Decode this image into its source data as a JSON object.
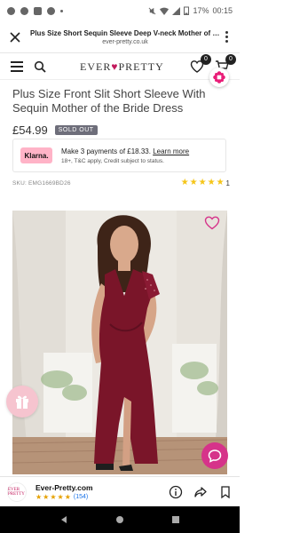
{
  "status_bar": {
    "battery": "17%",
    "time": "00:15"
  },
  "tab_header": {
    "title": "Plus Size Short Sequin Sleeve Deep V-neck Mother of the...",
    "url": "ever-pretty.co.uk"
  },
  "nav": {
    "logo_left": "EVER",
    "logo_right": "PRETTY",
    "wishlist_count": "0",
    "cart_count": "0"
  },
  "product": {
    "title": "Plus Size Front Slit Short Sleeve With Sequin Mother of the Bride Dress",
    "price": "£54.99",
    "stock_badge": "SOLD OUT",
    "sku": "SKU: EMG1669BD26",
    "rating_stars": 5,
    "review_count": "1"
  },
  "klarna": {
    "logo": "Klarna.",
    "message": "Make 3 payments of £18.33.",
    "link": "Learn more",
    "subtext": "18+, T&C apply, Credit subject to status."
  },
  "app_banner": {
    "logo_text": "EVER PRETTY",
    "name": "Ever-Pretty.com",
    "rating_stars": 4.5,
    "rating_count": "(154)"
  },
  "colors": {
    "brand": "#c2185b",
    "chat": "#d6338a",
    "gift": "#f6c4cf",
    "klarna": "#ffb3c7",
    "dress": "#7a1529",
    "stars": "#f5c518"
  },
  "icons": {
    "close": "close-icon",
    "menu": "hamburger-icon",
    "search": "search-icon",
    "wishlist": "heart-icon",
    "cart": "cart-icon",
    "gift": "gift-icon",
    "chat": "chat-icon",
    "info": "info-icon",
    "share": "share-icon",
    "bookmark": "bookmark-icon"
  }
}
